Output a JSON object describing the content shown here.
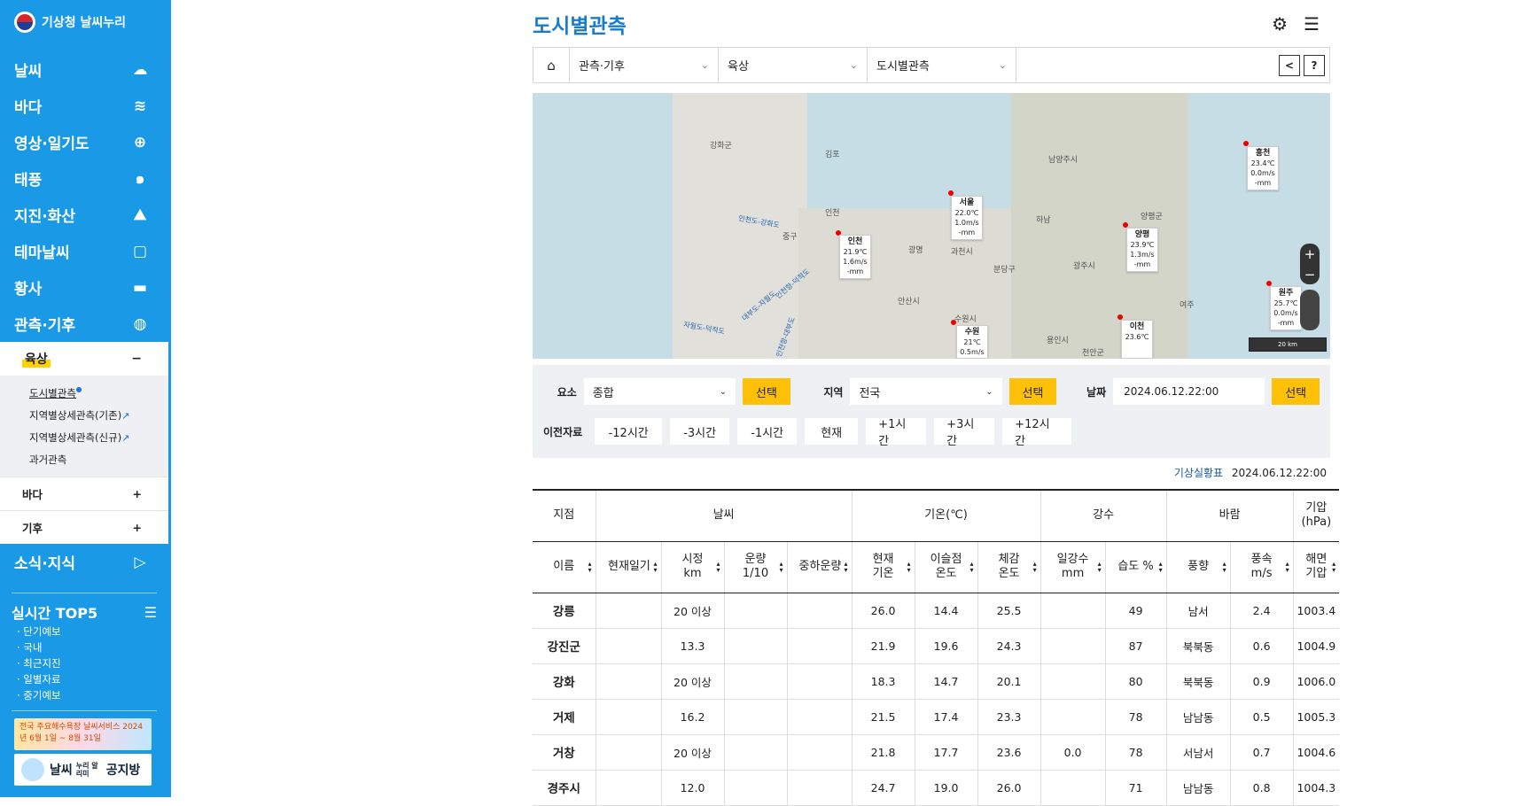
{
  "sidebar": {
    "logo": "기상청 날씨누리",
    "items": [
      {
        "label": "날씨",
        "icon": "cloud-sun-icon"
      },
      {
        "label": "바다",
        "icon": "wave-icon"
      },
      {
        "label": "영상·일기도",
        "icon": "satellite-icon"
      },
      {
        "label": "태풍",
        "icon": "typhoon-icon"
      },
      {
        "label": "지진·화산",
        "icon": "volcano-icon"
      },
      {
        "label": "테마날씨",
        "icon": "bag-icon"
      },
      {
        "label": "황사",
        "icon": "dust-icon"
      },
      {
        "label": "관측·기후",
        "icon": "globe-icon"
      }
    ],
    "sub": {
      "head": "육상",
      "head_sign": "−",
      "list": [
        "도시별관측",
        "지역별상세관측(기존)",
        "지역별상세관측(신규)",
        "과거관측"
      ],
      "rows": [
        {
          "label": "바다",
          "sign": "+"
        },
        {
          "label": "기후",
          "sign": "+"
        }
      ]
    },
    "news": {
      "label": "소식·지식",
      "icon": "play-icon"
    },
    "top5": {
      "title": "실시간 TOP5",
      "items": [
        "· 단기예보",
        "· 국내",
        "· 최근지진",
        "· 일별자료",
        "· 중기예보"
      ]
    },
    "banner1": "전국 주요해수욕장 날씨서비스 2024년 6월 1일 ~ 8월 31일",
    "banner2_a": "날씨",
    "banner2_b": "누리 알리미",
    "banner2_c": "공지방"
  },
  "header": {
    "title": "도시별관측"
  },
  "breadcrumb": {
    "s1": "관측·기후",
    "s2": "육상",
    "s3": "도시별관측",
    "help": "?"
  },
  "map": {
    "places": [
      "강화군",
      "김포",
      "인천",
      "중구",
      "양평군",
      "광명",
      "과천시",
      "남양주시",
      "하남",
      "광주시",
      "분당구",
      "용인시",
      "여주",
      "안산시",
      "수원시",
      "천안군"
    ],
    "sea": [
      "인천도-강화도",
      "자월도-덕적도",
      "대부도-자월도",
      "인천항-덕적도",
      "인천항-대부도"
    ],
    "markers": [
      {
        "name": "서울",
        "temp": "22.0℃",
        "wind": "1.0m/s",
        "rain": "-mm"
      },
      {
        "name": "인천",
        "temp": "21.9℃",
        "wind": "1.6m/s",
        "rain": "-mm"
      },
      {
        "name": "양평",
        "temp": "23.9℃",
        "wind": "1.3m/s",
        "rain": "-mm"
      },
      {
        "name": "홍천",
        "temp": "23.4℃",
        "wind": "0.0m/s",
        "rain": "-mm"
      },
      {
        "name": "원주",
        "temp": "25.7℃",
        "wind": "0.0m/s",
        "rain": "-mm"
      },
      {
        "name": "이천",
        "temp": "23.6℃",
        "wind": "",
        "rain": ""
      },
      {
        "name": "수원",
        "temp": "21℃",
        "wind": "0.5m/s",
        "rain": ""
      }
    ],
    "scale": "20 km",
    "zoom_in": "+",
    "zoom_out": "−"
  },
  "filter": {
    "element_label": "요소",
    "element_value": "종합",
    "region_label": "지역",
    "region_value": "전국",
    "date_label": "날짜",
    "date_value": "2024.06.12.22:00",
    "select_label": "선택",
    "prev_label": "이전자료",
    "time_buttons": [
      "-12시간",
      "-3시간",
      "-1시간",
      "현재",
      "+1시간",
      "+3시간",
      "+12시간"
    ]
  },
  "status": {
    "link": "기상실황표",
    "time": "2024.06.12.22:00"
  },
  "table": {
    "group_headers": [
      "지점",
      "날씨",
      "기온(℃)",
      "강수",
      "바람",
      "기압(hPa)"
    ],
    "headers": [
      "이름",
      "현재일기",
      "시정 km",
      "운량 1/10",
      "중하운량",
      "현재 기온",
      "이슬점 온도",
      "체감 온도",
      "일강수 mm",
      "습도 %",
      "풍향",
      "풍속 m/s",
      "해면 기압"
    ],
    "rows": [
      [
        "강릉",
        "",
        "20 이상",
        "",
        "",
        "26.0",
        "14.4",
        "25.5",
        "",
        "49",
        "남서",
        "2.4",
        "1003.4"
      ],
      [
        "강진군",
        "",
        "13.3",
        "",
        "",
        "21.9",
        "19.6",
        "24.3",
        "",
        "87",
        "북북동",
        "0.6",
        "1004.9"
      ],
      [
        "강화",
        "",
        "20 이상",
        "",
        "",
        "18.3",
        "14.7",
        "20.1",
        "",
        "80",
        "북북동",
        "0.9",
        "1006.0"
      ],
      [
        "거제",
        "",
        "16.2",
        "",
        "",
        "21.5",
        "17.4",
        "23.3",
        "",
        "78",
        "남남동",
        "0.5",
        "1005.3"
      ],
      [
        "거창",
        "",
        "20 이상",
        "",
        "",
        "21.8",
        "17.7",
        "23.6",
        "0.0",
        "78",
        "서남서",
        "0.7",
        "1004.6"
      ],
      [
        "경주시",
        "",
        "12.0",
        "",
        "",
        "24.7",
        "19.0",
        "26.0",
        "",
        "71",
        "남남동",
        "0.8",
        "1004.3"
      ]
    ]
  }
}
